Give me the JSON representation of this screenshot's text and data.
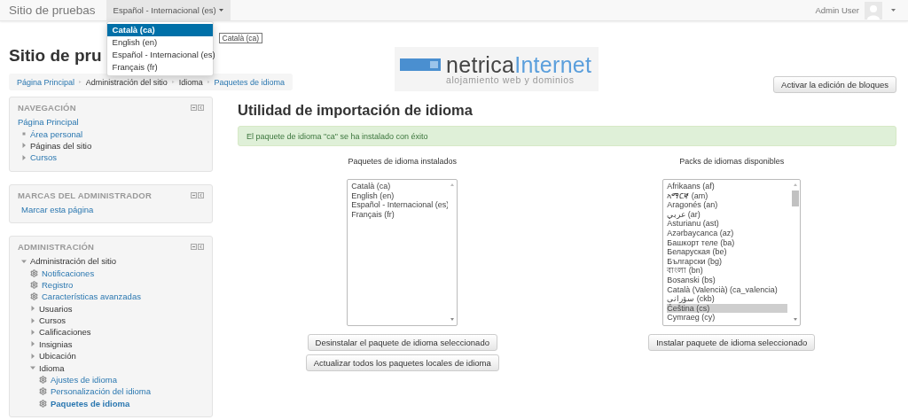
{
  "navbar": {
    "brand": "Sitio de pruebas",
    "language_menu": {
      "label": "Español - Internacional (es)",
      "expanded": true,
      "options": [
        {
          "label": "Català (ca)",
          "selected": true
        },
        {
          "label": "English (en)",
          "selected": false
        },
        {
          "label": "Español - Internacional (es)",
          "selected": false
        },
        {
          "label": "Français (fr)",
          "selected": false
        }
      ],
      "tooltip": "Català (ca)"
    },
    "user": "Admin User"
  },
  "header": {
    "heading": "Sitio de pru",
    "breadcrumb": [
      "Página Principal",
      "Administración del sitio",
      "Idioma",
      "Paquetes de idioma"
    ],
    "logo": {
      "name_dark": "netrica",
      "name_light": "Internet",
      "tagline": "alojamiento web y dominios"
    },
    "edit_button": "Activar la edición de bloques"
  },
  "blocks": [
    {
      "title": "NAVEGACIÓN",
      "kind": "navigation",
      "items": [
        {
          "label": "Página Principal",
          "kind": "root",
          "link": true
        },
        {
          "label": "Área personal",
          "kind": "leaf",
          "link": true
        },
        {
          "label": "Páginas del sitio",
          "kind": "branch",
          "link": false
        },
        {
          "label": "Cursos",
          "kind": "branch",
          "link": true
        }
      ]
    },
    {
      "title": "MARCAS DEL ADMINISTRADOR",
      "kind": "links",
      "items": [
        {
          "label": "Marcar esta página"
        }
      ]
    },
    {
      "title": "ADMINISTRACIÓN",
      "kind": "tree",
      "items": [
        {
          "label": "Administración del sitio",
          "kind": "folder",
          "expanded": true,
          "selected": false,
          "children": [
            {
              "label": "Notificaciones",
              "kind": "setting",
              "selected": false
            },
            {
              "label": "Registro",
              "kind": "setting",
              "selected": false
            },
            {
              "label": "Características avanzadas",
              "kind": "setting",
              "selected": false
            },
            {
              "label": "Usuarios",
              "kind": "folder",
              "expanded": false,
              "selected": false
            },
            {
              "label": "Cursos",
              "kind": "folder",
              "expanded": false,
              "selected": false
            },
            {
              "label": "Calificaciones",
              "kind": "folder",
              "expanded": false,
              "selected": false
            },
            {
              "label": "Insignias",
              "kind": "folder",
              "expanded": false,
              "selected": false
            },
            {
              "label": "Ubicación",
              "kind": "folder",
              "expanded": false,
              "selected": false
            },
            {
              "label": "Idioma",
              "kind": "folder",
              "expanded": true,
              "selected": false,
              "children": [
                {
                  "label": "Ajustes de idioma",
                  "kind": "setting",
                  "selected": false
                },
                {
                  "label": "Personalización del idioma",
                  "kind": "setting",
                  "selected": false
                },
                {
                  "label": "Paquetes de idioma",
                  "kind": "setting",
                  "selected": true
                }
              ]
            }
          ]
        }
      ]
    }
  ],
  "main": {
    "title": "Utilidad de importación de idioma",
    "alert": "El paquete de idioma \"ca\" se ha instalado con éxito",
    "columns": [
      {
        "heading": "Paquetes de idioma instalados",
        "scrollable": false,
        "options": [
          {
            "label": "Català (ca)",
            "selected": false
          },
          {
            "label": "English (en)",
            "selected": false
          },
          {
            "label": "Español - Internacional (es)",
            "selected": false
          },
          {
            "label": "Français (fr)",
            "selected": false
          }
        ],
        "buttons": [
          "Desinstalar el paquete de idioma seleccionado",
          "Actualizar todos los paquetes locales de idioma"
        ]
      },
      {
        "heading": "Packs de idiomas disponibles",
        "scrollable": true,
        "options": [
          {
            "label": "Afrikaans (af)",
            "selected": false
          },
          {
            "label": "አማርኛ (am)",
            "selected": false
          },
          {
            "label": "Aragonés (an)",
            "selected": false
          },
          {
            "label": "عربي (ar)",
            "selected": false
          },
          {
            "label": "Asturianu (ast)",
            "selected": false
          },
          {
            "label": "Azərbaycanca (az)",
            "selected": false
          },
          {
            "label": "Башкорт теле (ba)",
            "selected": false
          },
          {
            "label": "Беларуская (be)",
            "selected": false
          },
          {
            "label": "Български (bg)",
            "selected": false
          },
          {
            "label": "বাংলা (bn)",
            "selected": false
          },
          {
            "label": "Bosanski (bs)",
            "selected": false
          },
          {
            "label": "Català (Valencià) (ca_valencia)",
            "selected": false
          },
          {
            "label": "سۆرانی (ckb)",
            "selected": false
          },
          {
            "label": "Čeština (cs)",
            "selected": true
          },
          {
            "label": "Cymraeg (cy)",
            "selected": false
          }
        ],
        "buttons": [
          "Instalar paquete de idioma seleccionado"
        ]
      }
    ]
  }
}
